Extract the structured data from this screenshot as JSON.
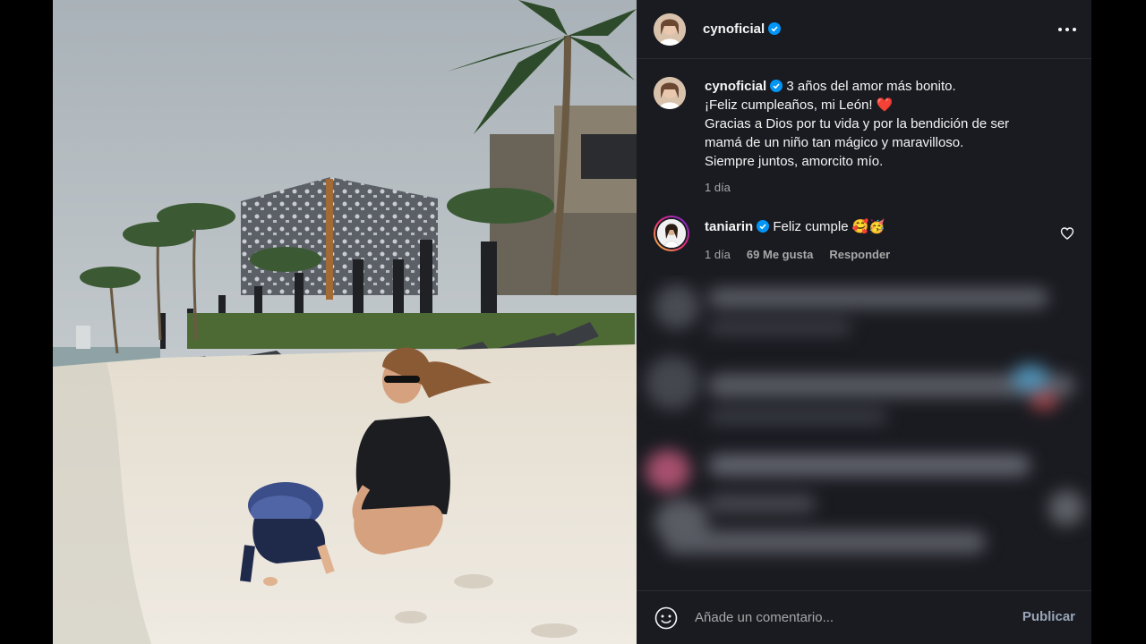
{
  "post": {
    "author": "cynoficial",
    "image_alt": "Mujer y niño jugando en la arena de una playa frente a un hotel con palmeras"
  },
  "caption": {
    "username": "cynoficial",
    "lines": [
      "3 años del amor más bonito.",
      "¡Feliz cumpleaños, mi León! ❤️",
      "Gracias a Dios por tu vida y por la bendición de ser",
      "mamá de un niño tan mágico y maravilloso.",
      "Siempre juntos, amorcito mío."
    ],
    "time": "1 día"
  },
  "comment": {
    "username": "taniarin",
    "text": "Feliz cumple 🥰🥳",
    "time": "1 día",
    "likes": "69 Me gusta",
    "reply": "Responder"
  },
  "footer": {
    "placeholder": "Añade un comentario...",
    "publish": "Publicar"
  },
  "colors": {
    "panel": "#1a1b21",
    "verified": "#0095f6",
    "muted": "#a8a8a8"
  },
  "icons": [
    "more-options-icon",
    "verified-badge-icon",
    "heart-icon",
    "emoji-icon"
  ]
}
